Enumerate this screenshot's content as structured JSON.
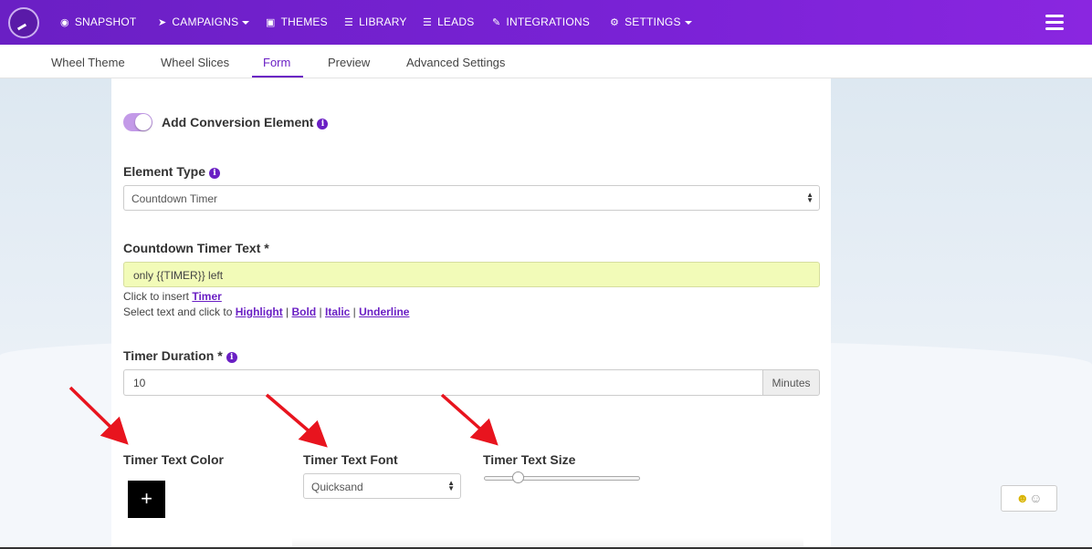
{
  "nav": {
    "items": [
      {
        "icon": "dashboard-icon",
        "glyph": "◉",
        "label": "SNAPSHOT"
      },
      {
        "icon": "paper-plane-icon",
        "glyph": "➤",
        "label": "CAMPAIGNS"
      },
      {
        "icon": "image-icon",
        "glyph": "▣",
        "label": "THEMES"
      },
      {
        "icon": "list-alt-icon",
        "glyph": "☰",
        "label": "LIBRARY"
      },
      {
        "icon": "list-icon",
        "glyph": "☰",
        "label": "LEADS"
      },
      {
        "icon": "plug-icon",
        "glyph": "✎",
        "label": "INTEGRATIONS"
      },
      {
        "icon": "cogs-icon",
        "glyph": "⚙",
        "label": "SETTINGS"
      }
    ]
  },
  "tabs": [
    {
      "label": "Wheel Theme"
    },
    {
      "label": "Wheel Slices"
    },
    {
      "label": "Form",
      "active": true
    },
    {
      "label": "Preview"
    },
    {
      "label": "Advanced Settings"
    }
  ],
  "form": {
    "conversion_toggle_label": "Add Conversion Element",
    "conversion_toggle_on": true,
    "element_type_label": "Element Type",
    "element_type_value": "Countdown Timer",
    "timer_text_label": "Countdown Timer Text *",
    "timer_text_value": "only {{TIMER}} left",
    "insert_prefix": "Click to insert ",
    "insert_link": "Timer",
    "format_prefix": "Select text and click to ",
    "format_links": [
      "Highlight",
      "Bold",
      "Italic",
      "Underline"
    ],
    "format_separator": " | ",
    "duration_label": "Timer Duration *",
    "duration_value": "10",
    "duration_unit": "Minutes",
    "color_label": "Timer Text Color",
    "color_button_glyph": "+",
    "font_label": "Timer Text Font",
    "font_value": "Quicksand",
    "size_label": "Timer Text Size",
    "size_slider_fraction": 0.2
  },
  "info_glyph": "i",
  "colors": {
    "brand_purple": "#6a1fc4",
    "highlight_field": "#f2fbb8",
    "annotation_arrow": "#e8141e"
  }
}
